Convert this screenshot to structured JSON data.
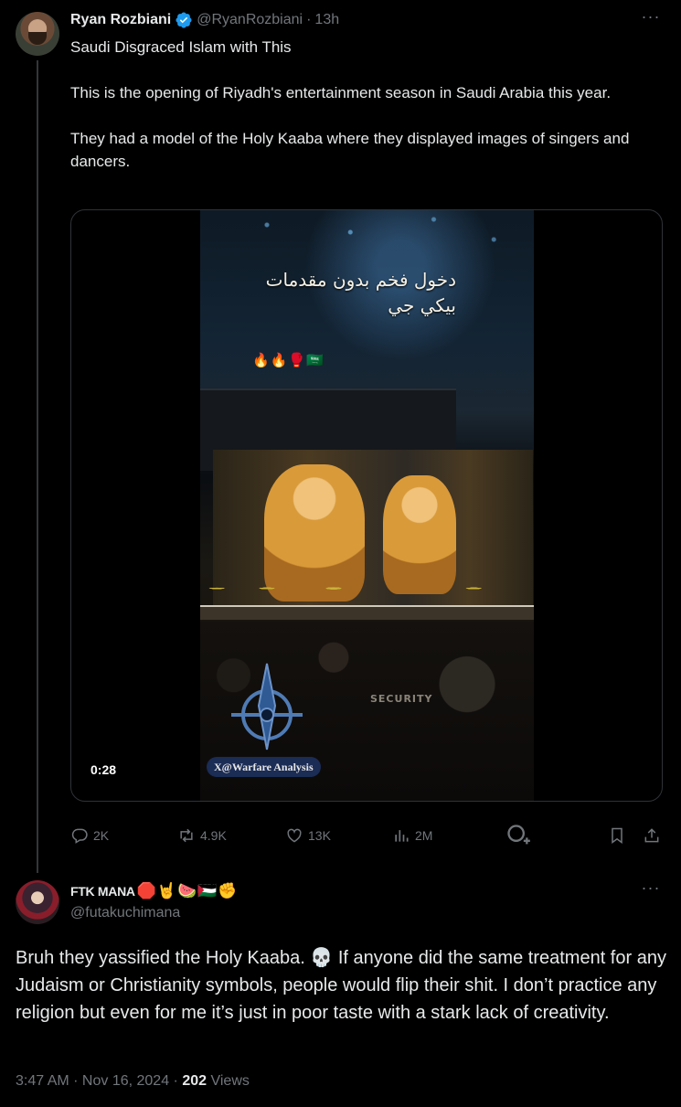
{
  "tweet": {
    "author_name": "Ryan Rozbiani",
    "author_handle": "@RyanRozbiani",
    "separator": "·",
    "time_ago": "13h",
    "more_label": "···",
    "paragraphs": [
      "Saudi Disgraced Islam with This",
      "This is the opening of Riyadh's entertainment season in Saudi Arabia this year.",
      "They had a model of the Holy Kaaba where they displayed images of singers and dancers."
    ],
    "video": {
      "overlay_arabic_line1": "دخول فخم بدون مقدمات",
      "overlay_arabic_line2": "بيكي جي",
      "overlay_emojis": "🔥🔥🥊🇸🇦",
      "security_text": "SECURITY",
      "watermark": "X@Warfare Analysis",
      "duration": "0:28"
    },
    "actions": {
      "replies": "2K",
      "reposts": "4.9K",
      "likes": "13K",
      "views": "2M"
    },
    "colors": {
      "verified": "#1d9bf0",
      "muted": "#71767b"
    }
  },
  "reply": {
    "author_name": "FTK MANA",
    "name_emojis": "🛑🤘🍉🇵🇸✊",
    "author_handle": "@futakuchimana",
    "more_label": "···",
    "text": "Bruh they yassified the Holy Kaaba. 💀 If anyone did the same treatment for any Judaism or Christianity symbols, people would flip their shit. I don’t practice any religion but even for me it’s just in poor taste with a stark lack of creativity.",
    "timestamp": "3:47 AM · Nov 16, 2024 · ",
    "views_count": "202",
    "views_label": " Views"
  }
}
